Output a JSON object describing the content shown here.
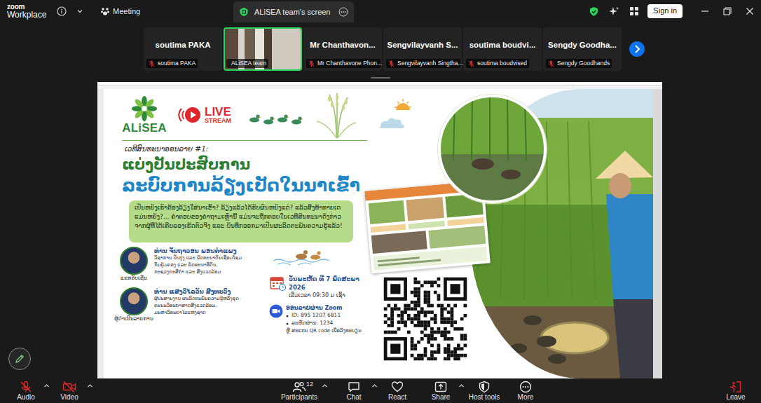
{
  "app": {
    "logo_top": "zoom",
    "logo_bottom": "Workplace"
  },
  "topbar": {
    "meeting": "Meeting",
    "share_tab": "ALiSEA team's screen",
    "sign_in": "Sign in"
  },
  "participants": [
    {
      "kind": "avatar",
      "tile_name": "soutima PAKA",
      "label": "soutima PAKA",
      "muted": true,
      "selected": false
    },
    {
      "kind": "video",
      "label": "ALiSEA team",
      "muted": false,
      "selected": true
    },
    {
      "kind": "avatar",
      "tile_name": "Mr Chanthavon...",
      "label": "Mr Chanthavone Phon...",
      "muted": true,
      "selected": false
    },
    {
      "kind": "avatar",
      "tile_name": "Sengvilayvanh S...",
      "label": "Sengvilayvanh Singtha...",
      "muted": true,
      "selected": false
    },
    {
      "kind": "avatar",
      "tile_name": "soutima boudvi...",
      "label": "soutima boudvised",
      "muted": true,
      "selected": false
    },
    {
      "kind": "avatar",
      "tile_name": "Sengdy Goodha...",
      "label": "Sengdy Goodhands",
      "muted": true,
      "selected": false
    }
  ],
  "poster": {
    "logo": "ALiSEA",
    "live": "LIVE",
    "stream": "STREAM",
    "series": "ເວທີສົນທະນາອອນລາຍ #1:",
    "title_1": "ແບ່ງປັນປະສົບການ",
    "title_2": "ລະບົບການລ້ຽງເປັດໃນນາເຂົ້າ",
    "intro": "ເປັນຫຍັງເຮົາຕ້ອງລ້ຽງໃສ່ນາເຂົ້າ? ລ້ຽງແລ້ວໄດ້ຮັບຜົນຫຍັງແດ່? ແລ້ວສິ່ງທ້າທາຍເດ ແມ່ນຫຍັງ?... ຄຳຕອບຂອງຄຳຖາມເຫຼົ່ານີ້ ແມ່ນຈະຖືກຕອບໃນເວທີສົນທະນາດັ່ງກ່າວ ຈາກຜູ້ທີ່ໄດ້ເຄີຍລອງເຮັດຕົວຈິງ ແລະ ບັນທຶກອອກມາເປັນຜະລິດຕະພັນຄວາມຮູ້ແລ້ວ!",
    "speakers": [
      {
        "name": "ທ່ານ ຈັນຖາວອນ ພອນຄຳແພງ",
        "details": [
          "ວິຊາການ ປັບປຸງ ແລະ ພັດທະນາດິນເຊື່ອມໂຊມ",
          "ກົມຄຸ້ມຄອງ ແລະ ພັດທະນາທີ່ດິນ,",
          "ກະຊວງກະສິກຳ ແລະ ສິ່ງແວດລ້ອມ"
        ],
        "role": "ແຂກຮັບເຊີນ"
      },
      {
        "name": "ທ່ານ ແສງວິໄລວັນ ສິງທະວົງ",
        "details": [
          "ຜູ້ປະສານງານ ຜະລິດຕະພັນຄວາມຮູ້ຫລັງຂຸດ",
          "ຄະນະວິທະຍາສາດສິ່ງແວດລ້ອມ,",
          "ມະຫາວິທະຍາໄລແຫ່ງຊາດ"
        ],
        "role": "ຜູ້ດຳເນີນລາຍການ"
      }
    ],
    "date": "ວັນພະຫັດ ທີ 7 ພຶດສະພາ 2026",
    "time": "ເລີ່ມເວລາ 09:30 ມ ເຊົ້າ",
    "online": "ອອນລາຍຜ່ານ Zoom",
    "zoom_lines": [
      "ID: 895 1207 6811",
      "ລະຫັດຜ່ານ: 1234"
    ],
    "qr_note": "ຫຼື ສະແກນ QR code ເພື່ອລົງທະບຽນ"
  },
  "toolbar": {
    "items": [
      {
        "label": "Audio",
        "muted": true,
        "menu": true
      },
      {
        "label": "Video",
        "muted": true,
        "menu": true
      },
      {
        "label": "Participants",
        "count": "12",
        "muted": false,
        "menu": true
      },
      {
        "label": "Chat",
        "muted": false,
        "menu": true
      },
      {
        "label": "React",
        "muted": false,
        "menu": false
      },
      {
        "label": "Share",
        "muted": false,
        "menu": true
      },
      {
        "label": "Host tools",
        "muted": false,
        "menu": false
      },
      {
        "label": "More",
        "muted": false,
        "menu": false
      }
    ],
    "leave": "Leave"
  }
}
